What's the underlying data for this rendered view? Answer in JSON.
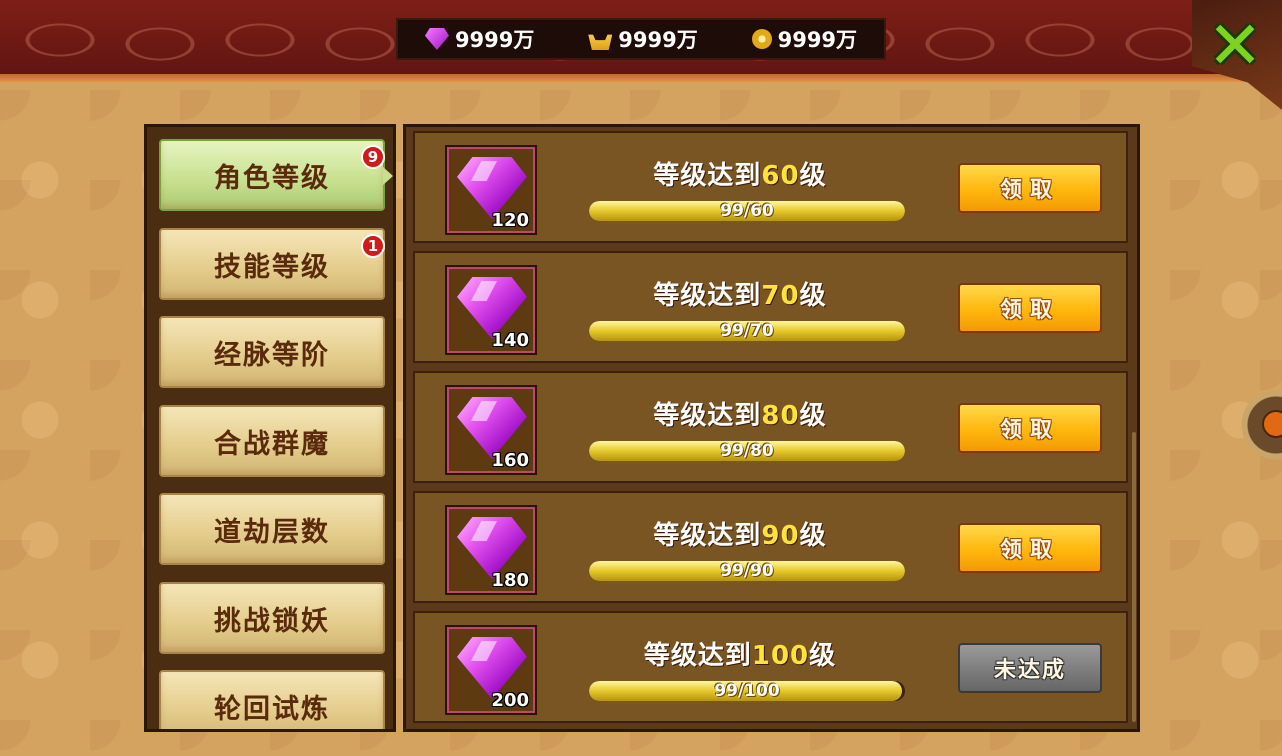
{
  "currencies": [
    {
      "icon": "gem-icon",
      "value": "9999万"
    },
    {
      "icon": "gold-ingot-icon",
      "value": "9999万"
    },
    {
      "icon": "coin-icon",
      "value": "9999万"
    }
  ],
  "close_glyph": "✕",
  "tabs": [
    {
      "label": "角色等级",
      "badge": "9",
      "active": true
    },
    {
      "label": "技能等级",
      "badge": "1",
      "active": false
    },
    {
      "label": "经脉等阶",
      "badge": "",
      "active": false
    },
    {
      "label": "合战群魔",
      "badge": "",
      "active": false
    },
    {
      "label": "道劫层数",
      "badge": "",
      "active": false
    },
    {
      "label": "挑战锁妖",
      "badge": "",
      "active": false
    },
    {
      "label": "轮回试炼",
      "badge": "",
      "active": false
    }
  ],
  "rewards": [
    {
      "quantity": "120",
      "req_prefix": "等级达到",
      "level": "60",
      "req_suffix": "级",
      "progress_text": "99/60",
      "progress": 1.0,
      "button": "领取",
      "claimable": true
    },
    {
      "quantity": "140",
      "req_prefix": "等级达到",
      "level": "70",
      "req_suffix": "级",
      "progress_text": "99/70",
      "progress": 1.0,
      "button": "领取",
      "claimable": true
    },
    {
      "quantity": "160",
      "req_prefix": "等级达到",
      "level": "80",
      "req_suffix": "级",
      "progress_text": "99/80",
      "progress": 1.0,
      "button": "领取",
      "claimable": true
    },
    {
      "quantity": "180",
      "req_prefix": "等级达到",
      "level": "90",
      "req_suffix": "级",
      "progress_text": "99/90",
      "progress": 1.0,
      "button": "领取",
      "claimable": true
    },
    {
      "quantity": "200",
      "req_prefix": "等级达到",
      "level": "100",
      "req_suffix": "级",
      "progress_text": "99/100",
      "progress": 0.99,
      "button": "未达成",
      "claimable": false
    }
  ],
  "colors": {
    "accent_level": "#ffe23a",
    "claim_button": "#ffb70d",
    "disabled_button": "#7d7d7d",
    "active_tab": "#c7df8e"
  }
}
